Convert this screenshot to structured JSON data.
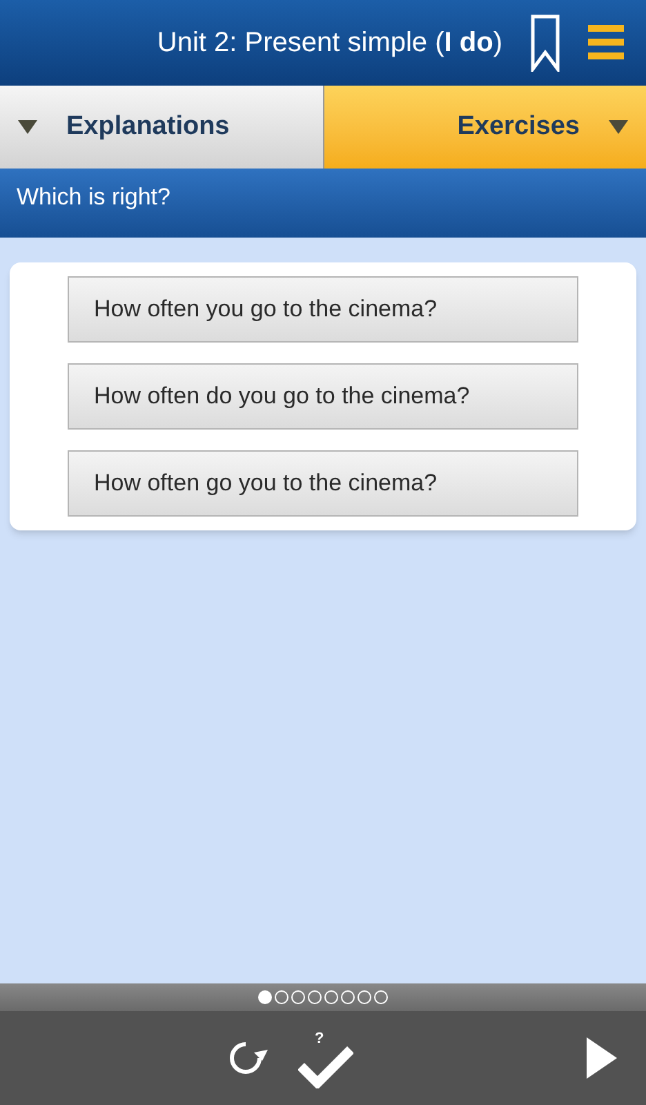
{
  "header": {
    "title": "Unit 2: Present simple (**I do**)"
  },
  "tabs": [
    {
      "label": "Explanations",
      "selected": false
    },
    {
      "label": "Exercises",
      "selected": true
    }
  ],
  "question": "Which is right?",
  "options": [
    {
      "text": "How often you go to the cinema?"
    },
    {
      "text": "How often do you go to the cinema?"
    },
    {
      "text": "How often go you to the cinema?"
    }
  ],
  "pager": [
    {
      "selected": true
    },
    {
      "selected": false
    },
    {
      "selected": false
    },
    {
      "selected": false
    },
    {
      "selected": false
    },
    {
      "selected": false
    },
    {
      "selected": false
    },
    {
      "selected": false
    }
  ],
  "toolbar": {
    "check_hint": "?"
  }
}
